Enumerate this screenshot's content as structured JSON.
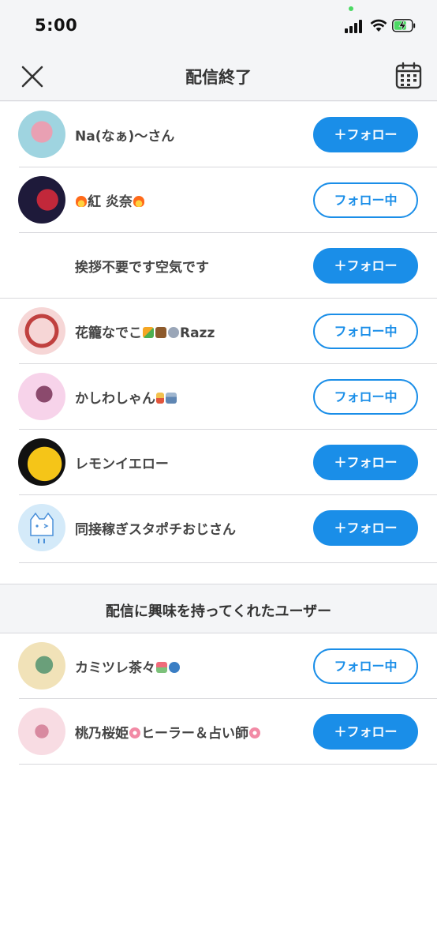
{
  "status": {
    "time": "5:00"
  },
  "header": {
    "title": "配信終了"
  },
  "buttons": {
    "follow": "＋フォロー",
    "following": "フォロー中"
  },
  "viewers": [
    {
      "name": "Na(なぁ)〜さん",
      "state": "follow",
      "avatar_colors": [
        "#9fd4e0",
        "#e9a0b3"
      ]
    },
    {
      "name": "紅 炎奈",
      "prefix_emoji": "fire-emoji",
      "suffix_emoji": "fire-emoji",
      "state": "following",
      "avatar_colors": [
        "#1e1a3a",
        "#c2283a"
      ]
    },
    {
      "name": "挨拶不要です空気です",
      "state": "follow",
      "avatar_colors": [
        "#ffffff",
        "#ffffff"
      ]
    },
    {
      "name": "花籠なでこ",
      "suffix_text": "Razz",
      "emojis": [
        "bouquet-emoji",
        "basket-emoji",
        "rabbit-emoji"
      ],
      "state": "following",
      "avatar_colors": [
        "#f6d6d6",
        "#c0403f"
      ]
    },
    {
      "name": "かしわしゃん",
      "emojis": [
        "food-emoji",
        "bottle-emoji"
      ],
      "state": "following",
      "avatar_colors": [
        "#f7d3ea",
        "#8b4a6d"
      ]
    },
    {
      "name": "レモンイエロー",
      "state": "follow",
      "avatar_colors": [
        "#111111",
        "#f5c518"
      ]
    },
    {
      "name": "同接稼ぎスタポチおじさん",
      "state": "follow",
      "avatar_colors": [
        "#d4eaf9",
        "#4a90d9"
      ]
    }
  ],
  "section": {
    "title": "配信に興味を持ってくれたユーザー"
  },
  "interested": [
    {
      "name": "カミツレ茶々",
      "emojis": [
        "flower-pot-emoji",
        "teapot-emoji"
      ],
      "state": "following",
      "avatar_colors": [
        "#f1e2b8",
        "#6a9f7a"
      ]
    },
    {
      "name": "桃乃桜姫",
      "middle_text": "ヒーラー＆占い師",
      "emojis": [
        "sakura-emoji",
        "sakura-emoji"
      ],
      "state": "follow",
      "avatar_colors": [
        "#f8dce3",
        "#d88aa0"
      ]
    }
  ]
}
